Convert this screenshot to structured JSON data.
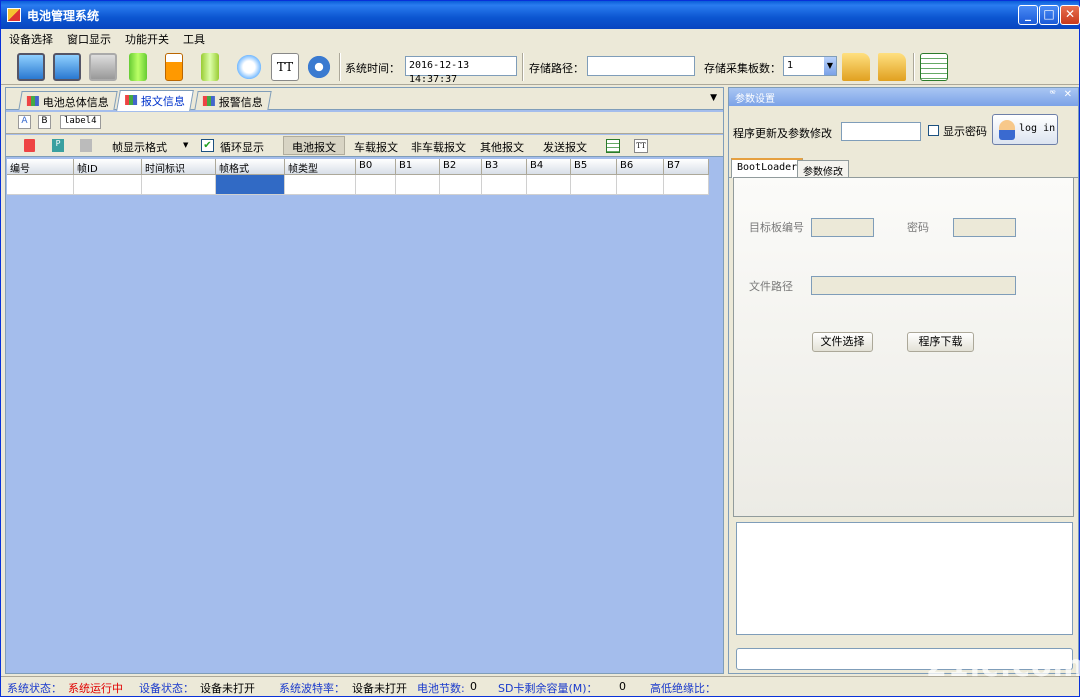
{
  "window": {
    "title": "电池管理系统"
  },
  "menu": [
    "设备选择",
    "窗口显示",
    "功能开关",
    "工具"
  ],
  "toolbar": {
    "time_label": "系统时间：",
    "time_value": "2016-12-13 14:37:37",
    "path_label": "存储路径：",
    "path_value": "",
    "boards_label": "存储采集板数：",
    "boards_value": "1",
    "tt": "TT"
  },
  "tabs": [
    "电池总体信息",
    "报文信息",
    "报警信息"
  ],
  "strip1": {
    "a": "A",
    "b": "B",
    "label": "label4"
  },
  "strip2": {
    "format": "帧显示格式",
    "loop": "循环显示",
    "items": [
      "电池报文",
      "车载报文",
      "非车载报文",
      "其他报文",
      "发送报文"
    ],
    "tt": "TT"
  },
  "grid_headers": [
    "编号",
    "帧ID",
    "时间标识",
    "帧格式",
    "帧类型",
    "B0",
    "B1",
    "B2",
    "B3",
    "B4",
    "B5",
    "B6",
    "B7"
  ],
  "right": {
    "title": "参数设置",
    "update_label": "程序更新及参数修改",
    "show_pwd": "显示密码",
    "login": "log in",
    "tabs": [
      "BootLoader",
      "参数修改"
    ],
    "target_label": "目标板编号",
    "pwd_label": "密码",
    "file_label": "文件路径",
    "choose_btn": "文件选择",
    "download_btn": "程序下载"
  },
  "status": {
    "sys_label": "系统状态：",
    "sys_value": "系统运行中",
    "dev_label": "设备状态：",
    "dev_value": "设备未打开",
    "baud_label": "系统波特率：",
    "baud_value": "设备未打开",
    "cells_label": "电池节数:",
    "cells_value": "0",
    "sd_label": "SD卡剩余容量(M)：",
    "sd_value": "0",
    "ins_label": "高低绝缘比："
  },
  "watermark": "21ic.com"
}
